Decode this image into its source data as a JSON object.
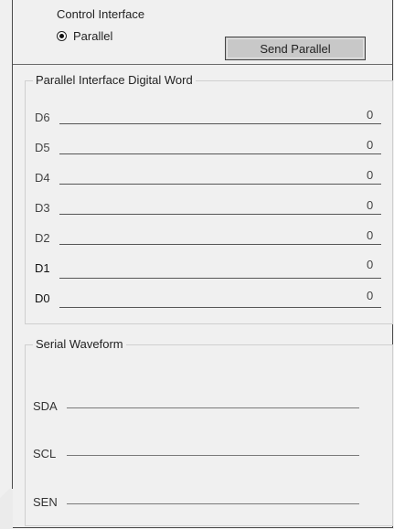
{
  "control": {
    "title": "Control Interface",
    "radio_label": "Parallel",
    "radio_selected": true,
    "send_button": "Send Parallel"
  },
  "parallel": {
    "title": "Parallel Interface Digital Word",
    "bits": [
      {
        "label": "D6",
        "value": "0"
      },
      {
        "label": "D5",
        "value": "0"
      },
      {
        "label": "D4",
        "value": "0"
      },
      {
        "label": "D3",
        "value": "0"
      },
      {
        "label": "D2",
        "value": "0"
      },
      {
        "label": "D1",
        "value": "0"
      },
      {
        "label": "D0",
        "value": "0"
      }
    ]
  },
  "serial": {
    "title": "Serial Waveform",
    "signals": [
      {
        "label": "SDA"
      },
      {
        "label": "SCL"
      },
      {
        "label": "SEN"
      }
    ]
  }
}
